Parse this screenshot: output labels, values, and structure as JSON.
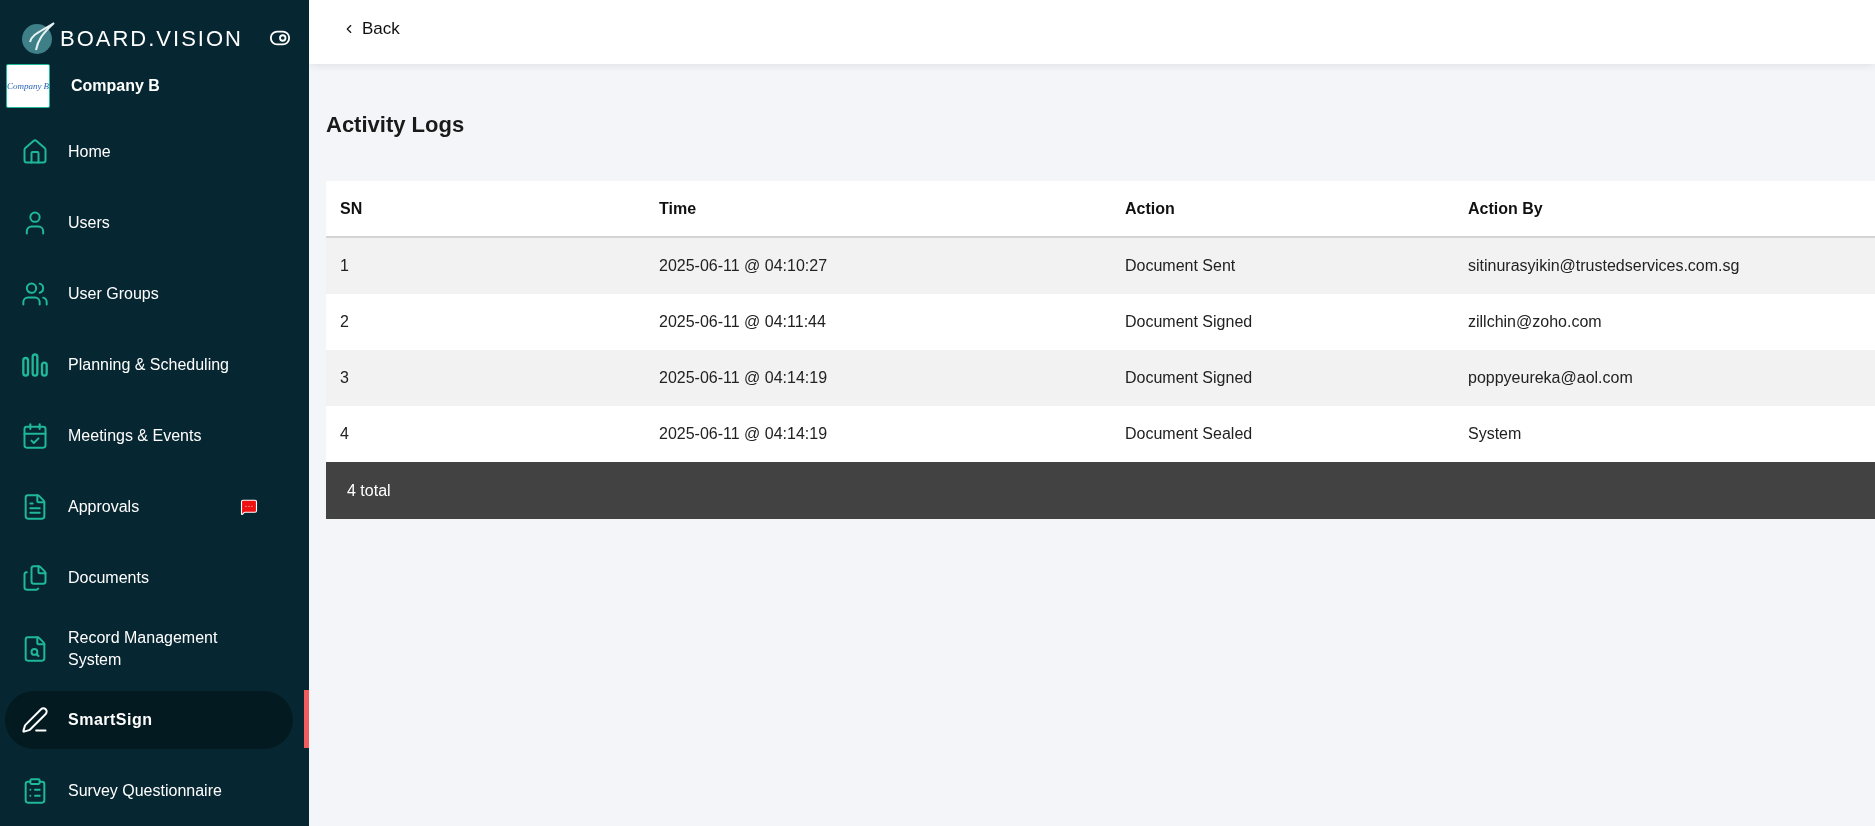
{
  "brand": {
    "name": "BOARD.VISION"
  },
  "company": {
    "logo_text": "Company B",
    "name": "Company B"
  },
  "sidebar": {
    "items": [
      {
        "kind": "home",
        "label": "Home",
        "selected": false,
        "notification": false
      },
      {
        "kind": "user",
        "label": "Users",
        "selected": false,
        "notification": false
      },
      {
        "kind": "group",
        "label": "User Groups",
        "selected": false,
        "notification": false
      },
      {
        "kind": "planning",
        "label": "Planning & Scheduling",
        "selected": false,
        "notification": false
      },
      {
        "kind": "meetings",
        "label": "Meetings & Events",
        "selected": false,
        "notification": false
      },
      {
        "kind": "approvals",
        "label": "Approvals",
        "selected": false,
        "notification": true
      },
      {
        "kind": "documents",
        "label": "Documents",
        "selected": false,
        "notification": false
      },
      {
        "kind": "records",
        "label": "Record Management System",
        "selected": false,
        "notification": false
      },
      {
        "kind": "sign",
        "label": "SmartSign",
        "selected": true,
        "notification": false
      },
      {
        "kind": "survey",
        "label": "Survey Questionnaire",
        "selected": false,
        "notification": false
      }
    ]
  },
  "header": {
    "back": "Back"
  },
  "page": {
    "title": "Activity Logs"
  },
  "table": {
    "columns": [
      "SN",
      "Time",
      "Action",
      "Action By"
    ],
    "rows": [
      [
        "1",
        "2025-06-11 @ 04:10:27",
        "Document Sent",
        "sitinurasyikin@trustedservices.com.sg"
      ],
      [
        "2",
        "2025-06-11 @ 04:11:44",
        "Document Signed",
        "zillchin@zoho.com"
      ],
      [
        "3",
        "2025-06-11 @ 04:14:19",
        "Document Signed",
        "poppyeureka@aol.com"
      ],
      [
        "4",
        "2025-06-11 @ 04:14:19",
        "Document Sealed",
        "System"
      ]
    ],
    "footer": "4 total"
  }
}
